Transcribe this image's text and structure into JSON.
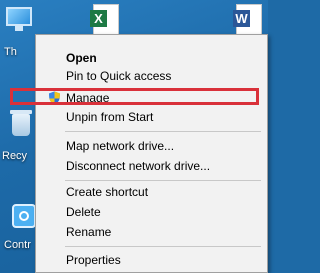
{
  "desktop": {
    "icons": [
      {
        "label": "Th"
      },
      {
        "label": "Recy"
      },
      {
        "label": "Contr"
      }
    ]
  },
  "context_menu": {
    "items": [
      {
        "label": "Open",
        "bold": true
      },
      {
        "label": "Pin to Quick access"
      },
      {
        "label": "Manage",
        "icon": "uac-shield-icon",
        "highlighted": true
      },
      {
        "label": "Unpin from Start"
      },
      {
        "label": "Map network drive..."
      },
      {
        "label": "Disconnect network drive..."
      },
      {
        "label": "Create shortcut"
      },
      {
        "label": "Delete"
      },
      {
        "label": "Rename"
      },
      {
        "label": "Properties"
      }
    ]
  },
  "colors": {
    "highlight_border": "#d9313a",
    "menu_background": "#f2f2f2",
    "desktop_background": "#1e6aa6"
  }
}
